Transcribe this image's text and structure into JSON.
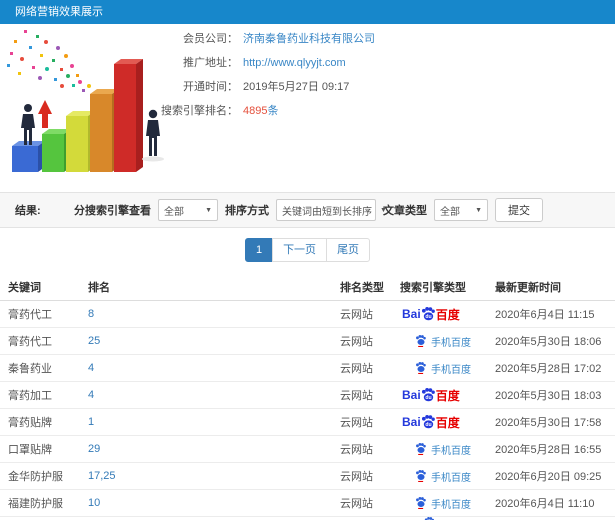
{
  "header": {
    "title": "网络营销效果展示"
  },
  "info": {
    "fields": [
      {
        "label": "会员公司：",
        "value": "济南秦鲁药业科技有限公司"
      },
      {
        "label": "推广地址：",
        "value": "http://www.qlyyjt.com"
      },
      {
        "label": "开通时间：",
        "value": "2019年5月27日 09:17"
      },
      {
        "label": "搜索引擎排名：",
        "value": "4895",
        "suffix": "条"
      }
    ]
  },
  "filters": {
    "section_label": "结果:",
    "engine_label": "分搜索引擎查看",
    "engine_value": "全部",
    "sort_label": "排序方式",
    "sort_value": "关键词由短到长排序",
    "article_label": "文章类型",
    "article_value": "全部",
    "submit_label": "提交",
    "dropdown_arrow": "▼"
  },
  "pagination": {
    "current": "1",
    "next_label": "下一页",
    "last_label": "尾页"
  },
  "table": {
    "headers": [
      "关键词",
      "排名",
      "排名类型",
      "搜索引擎类型",
      "最新更新时间"
    ],
    "engines": {
      "baidu": {
        "bai": "Bai",
        "du": "du",
        "cn": "百度"
      },
      "mobile": {
        "label": "手机百度"
      }
    },
    "rows": [
      {
        "keyword": "膏药代工",
        "rank": "8",
        "rank_type": "云网站",
        "engine": "baidu",
        "updated": "2020年6月4日 11:15"
      },
      {
        "keyword": "膏药代工",
        "rank": "25",
        "rank_type": "云网站",
        "engine": "baidu-mobile",
        "updated": "2020年5月30日 18:06"
      },
      {
        "keyword": "秦鲁药业",
        "rank": "4",
        "rank_type": "云网站",
        "engine": "baidu-mobile",
        "updated": "2020年5月28日 17:02"
      },
      {
        "keyword": "膏药加工",
        "rank": "4",
        "rank_type": "云网站",
        "engine": "baidu",
        "updated": "2020年5月30日 18:03"
      },
      {
        "keyword": "膏药贴牌",
        "rank": "1",
        "rank_type": "云网站",
        "engine": "baidu",
        "updated": "2020年5月30日 17:58"
      },
      {
        "keyword": "口罩贴牌",
        "rank": "29",
        "rank_type": "云网站",
        "engine": "baidu-mobile",
        "updated": "2020年5月28日 16:55"
      },
      {
        "keyword": "金华防护服",
        "rank": "17,25",
        "rank_type": "云网站",
        "engine": "baidu-mobile",
        "updated": "2020年6月20日 09:25"
      },
      {
        "keyword": "福建防护服",
        "rank": "10",
        "rank_type": "云网站",
        "engine": "baidu-mobile",
        "updated": "2020年6月4日 11:10"
      }
    ]
  },
  "colors": {
    "header_bg": "#1787cb",
    "link_blue": "#3a87c6",
    "rank_blue": "#337ab7",
    "highlight_red": "#e4503c",
    "baidu_blue": "#2439dc",
    "baidu_red": "#e60000"
  }
}
